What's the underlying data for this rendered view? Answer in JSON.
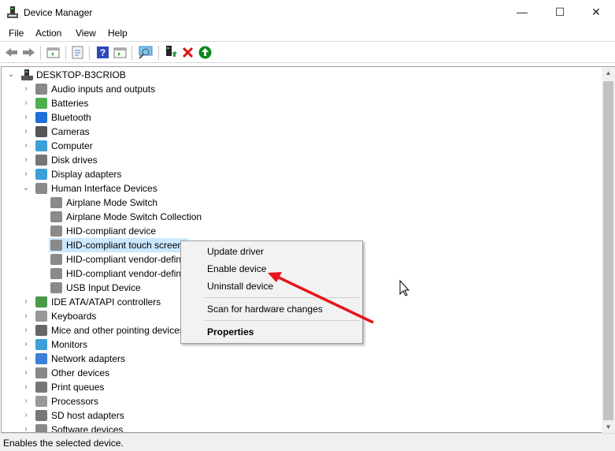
{
  "window": {
    "title": "Device Manager",
    "minimize": "—",
    "maximize": "☐",
    "close": "✕"
  },
  "menu": [
    "File",
    "Action",
    "View",
    "Help"
  ],
  "toolbar": [
    "back-icon",
    "forward-icon",
    "show-hide-console-tree-icon",
    "properties-icon",
    "help-icon",
    "show-action-pane-icon",
    "scan-hardware-icon",
    "update-driver-icon",
    "uninstall-icon",
    "enable-icon"
  ],
  "tree": {
    "root": "DESKTOP-B3CRIOB",
    "categories": [
      {
        "label": "Audio inputs and outputs",
        "color": "#888888"
      },
      {
        "label": "Batteries",
        "color": "#4caf50"
      },
      {
        "label": "Bluetooth",
        "color": "#1e6fd9"
      },
      {
        "label": "Cameras",
        "color": "#555555"
      },
      {
        "label": "Computer",
        "color": "#3b9fd8"
      },
      {
        "label": "Disk drives",
        "color": "#777777"
      },
      {
        "label": "Display adapters",
        "color": "#3b9fd8"
      },
      {
        "label": "Human Interface Devices",
        "color": "#8a8a8a",
        "expanded": true,
        "children": [
          "Airplane Mode Switch",
          "Airplane Mode Switch Collection",
          "HID-compliant device",
          "HID-compliant touch screen",
          "HID-compliant vendor-defined device",
          "HID-compliant vendor-defined device",
          "USB Input Device"
        ]
      },
      {
        "label": "IDE ATA/ATAPI controllers",
        "color": "#4a9a4a"
      },
      {
        "label": "Keyboards",
        "color": "#999999"
      },
      {
        "label": "Mice and other pointing devices",
        "color": "#666666"
      },
      {
        "label": "Monitors",
        "color": "#3b9fd8"
      },
      {
        "label": "Network adapters",
        "color": "#3b7fd8"
      },
      {
        "label": "Other devices",
        "color": "#888888"
      },
      {
        "label": "Print queues",
        "color": "#777777"
      },
      {
        "label": "Processors",
        "color": "#999999"
      },
      {
        "label": "SD host adapters",
        "color": "#777777"
      },
      {
        "label": "Software devices",
        "color": "#888888"
      }
    ]
  },
  "context_menu": {
    "items": [
      "Update driver",
      "Enable device",
      "Uninstall device",
      "Scan for hardware changes",
      "Properties"
    ]
  },
  "status": "Enables the selected device.",
  "annotation_color": "#e8141b"
}
